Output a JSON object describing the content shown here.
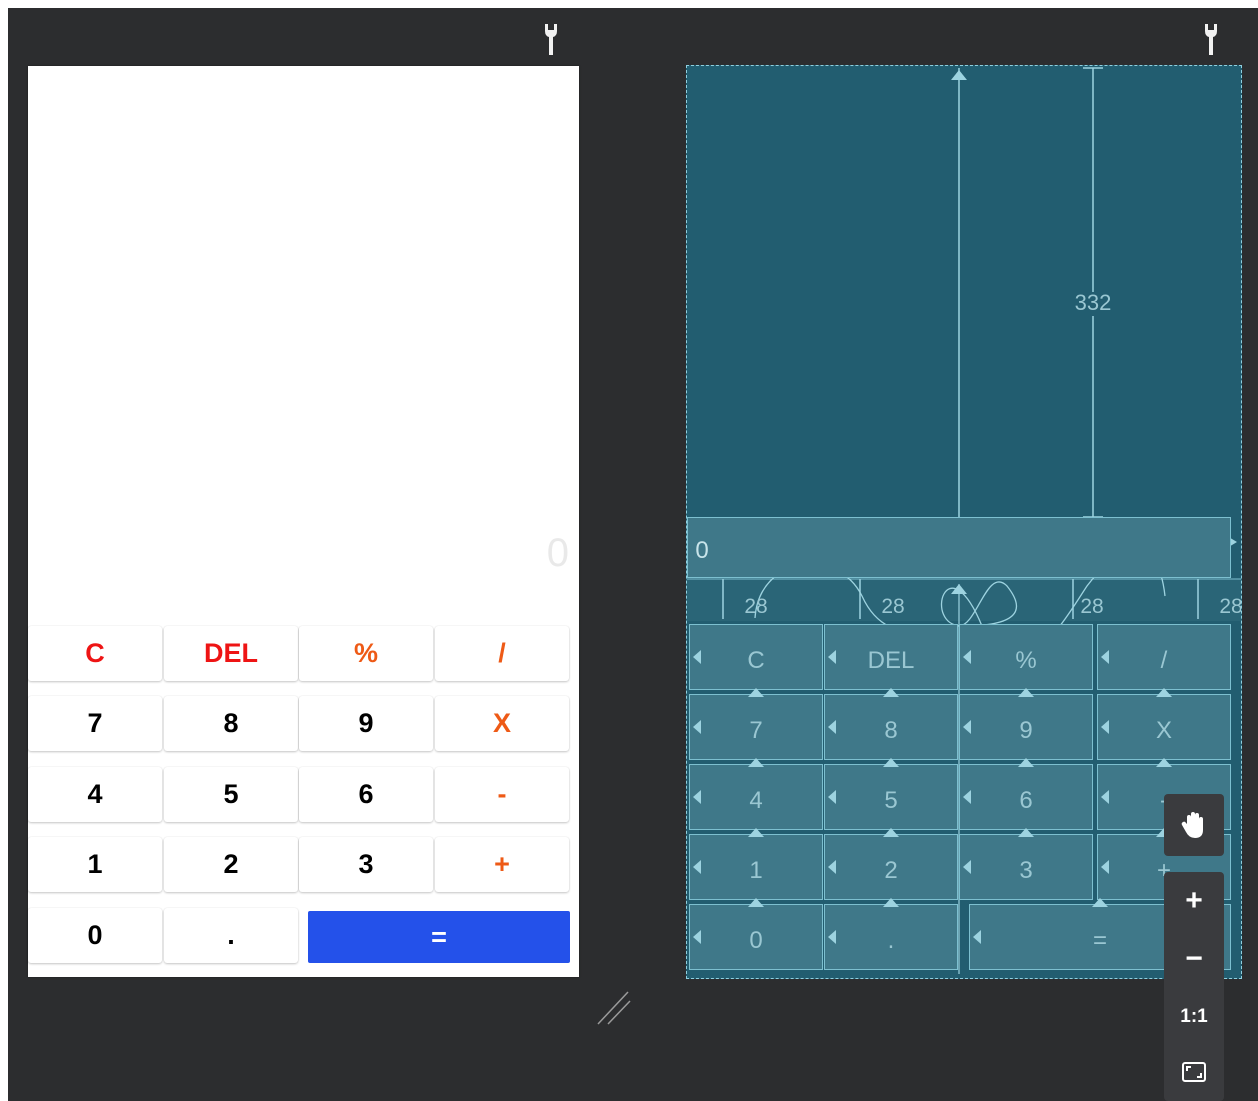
{
  "preview": {
    "display": "0",
    "rows": [
      [
        {
          "label": "C",
          "color": "red"
        },
        {
          "label": "DEL",
          "color": "red"
        },
        {
          "label": "%",
          "color": "orange"
        },
        {
          "label": "/",
          "color": "orange"
        }
      ],
      [
        {
          "label": "7",
          "color": "black"
        },
        {
          "label": "8",
          "color": "black"
        },
        {
          "label": "9",
          "color": "black"
        },
        {
          "label": "X",
          "color": "orange"
        }
      ],
      [
        {
          "label": "4",
          "color": "black"
        },
        {
          "label": "5",
          "color": "black"
        },
        {
          "label": "6",
          "color": "black"
        },
        {
          "label": "-",
          "color": "orange"
        }
      ],
      [
        {
          "label": "1",
          "color": "black"
        },
        {
          "label": "2",
          "color": "black"
        },
        {
          "label": "3",
          "color": "black"
        },
        {
          "label": "+",
          "color": "orange"
        }
      ],
      [
        {
          "label": "0",
          "color": "black"
        },
        {
          "label": ".",
          "color": "black"
        },
        {
          "label": "=",
          "color": "white"
        }
      ]
    ]
  },
  "blueprint": {
    "top_margin": "332",
    "display": "0",
    "chain_margins": [
      "28",
      "28",
      "28",
      "28"
    ],
    "rows": [
      [
        "C",
        "DEL",
        "%",
        "/"
      ],
      [
        "7",
        "8",
        "9",
        "X"
      ],
      [
        "4",
        "5",
        "6",
        "-"
      ],
      [
        "1",
        "2",
        "3",
        "+"
      ],
      [
        "0",
        ".",
        "="
      ]
    ]
  },
  "toolbar": {
    "pan_icon": "hand-icon",
    "zoom_in": "+",
    "zoom_out": "−",
    "actual_size": "1:1",
    "fit_icon": "fit-screen-icon"
  },
  "colors": {
    "canvas": "#2c2d2f",
    "blueprint": "#225d70",
    "equals": "#2451ea",
    "red": "#ee1414",
    "orange": "#ee5a16"
  }
}
